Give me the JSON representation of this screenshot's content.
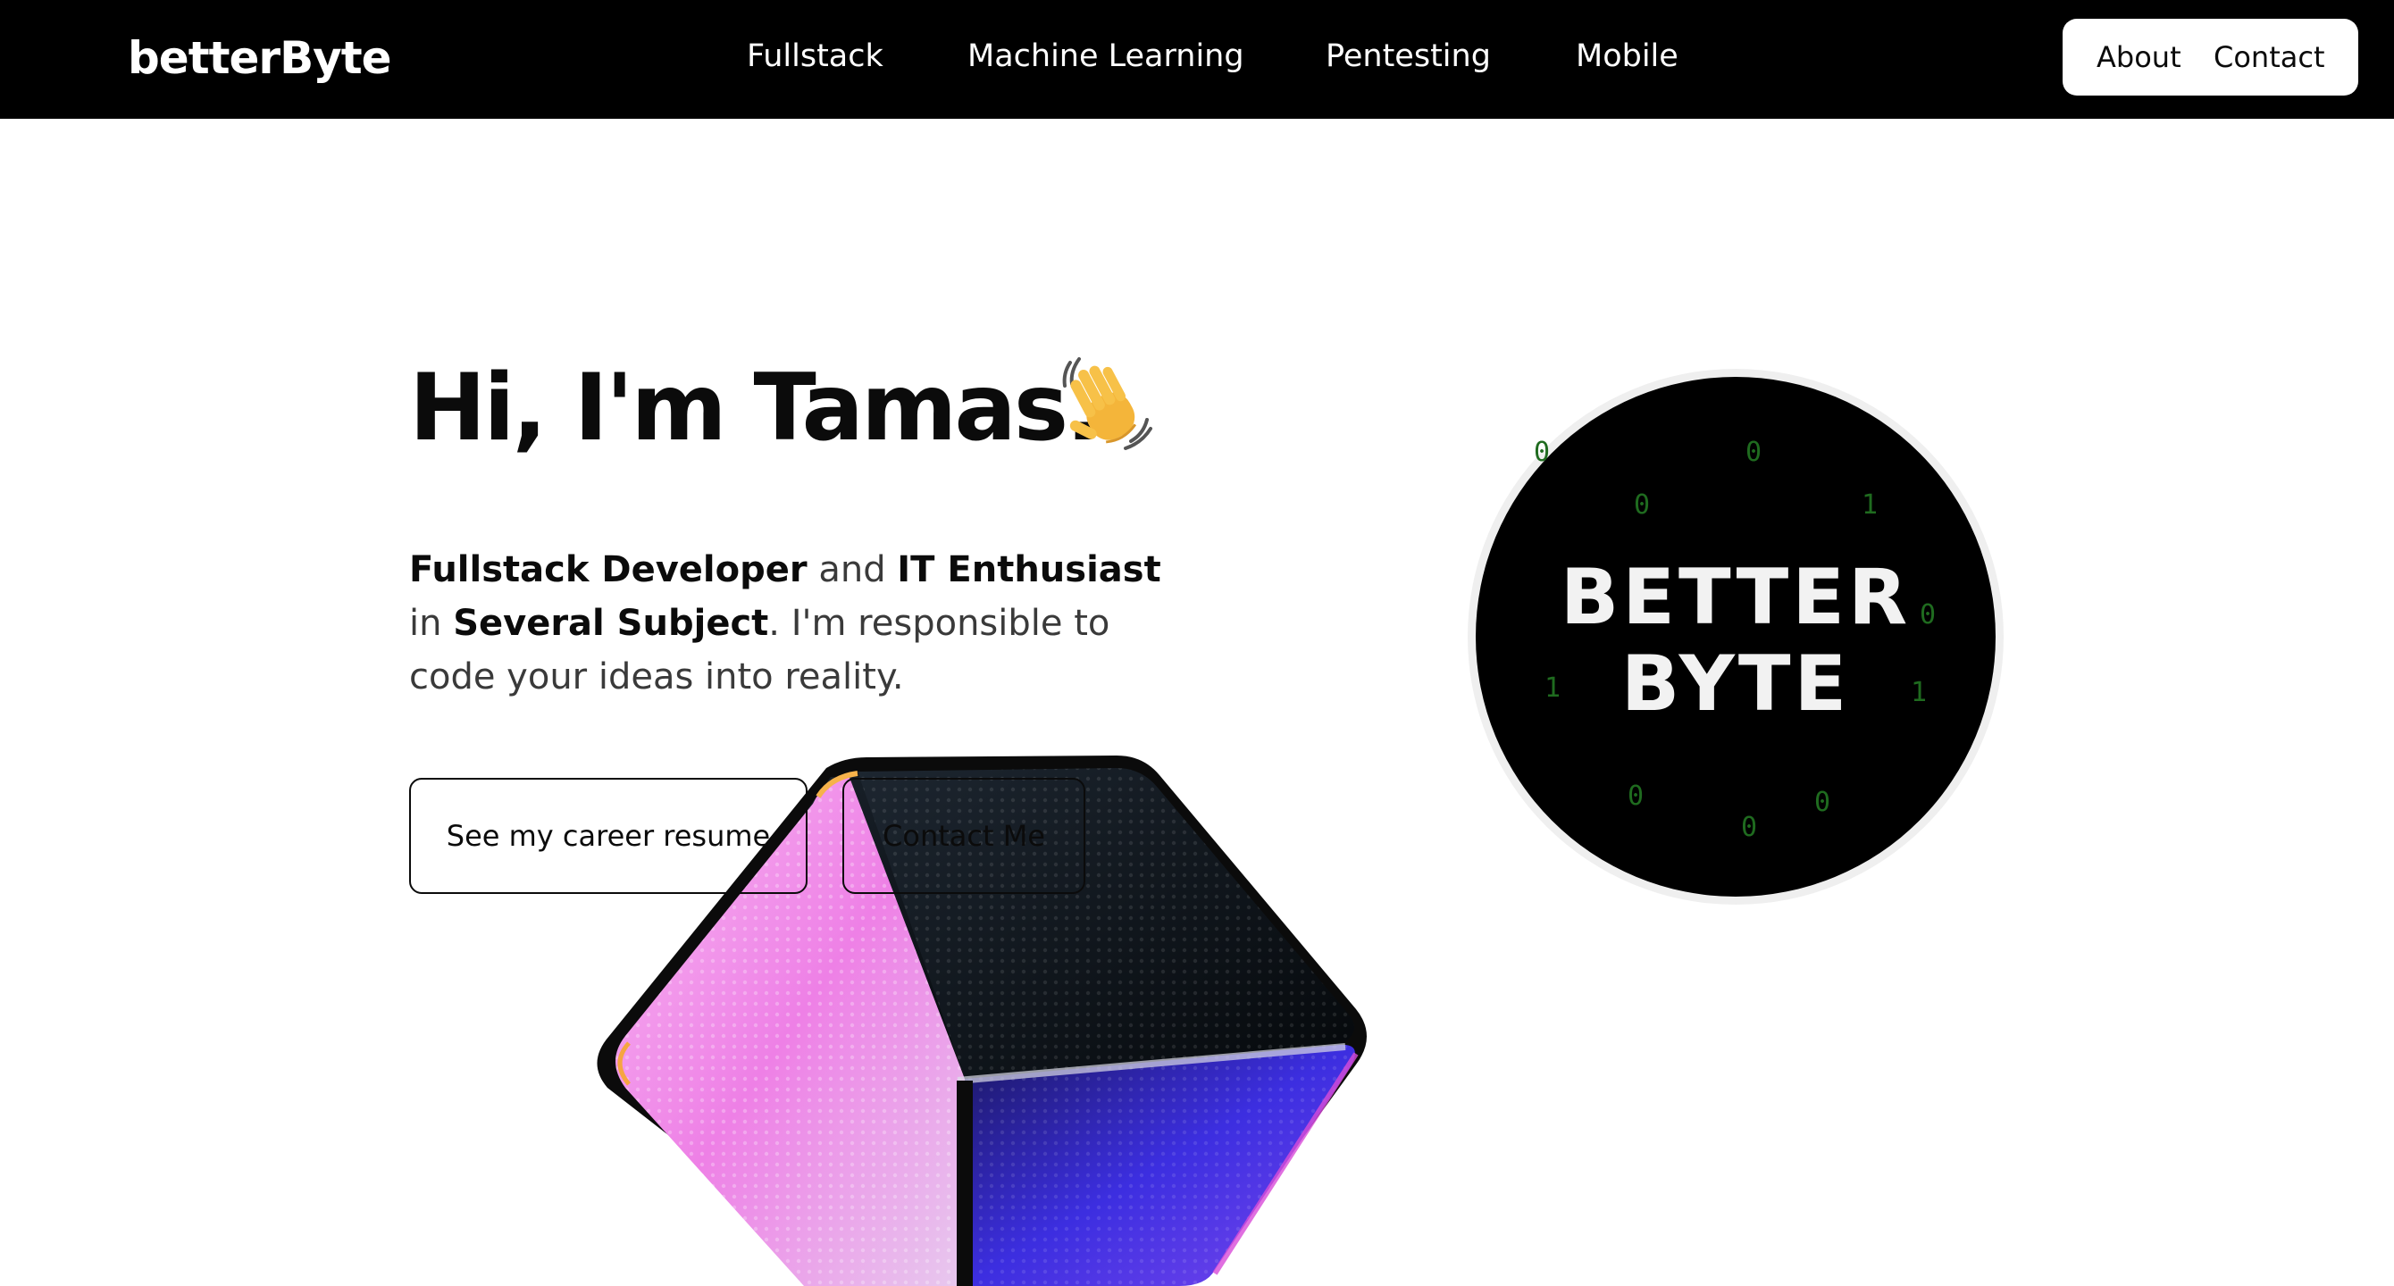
{
  "header": {
    "brand": "betterByte",
    "nav": [
      "Fullstack",
      "Machine Learning",
      "Pentesting",
      "Mobile"
    ],
    "pill_links": [
      "About",
      "Contact"
    ]
  },
  "hero": {
    "title": "Hi, I'm Tamas.",
    "title_icon": "waving-hand-icon",
    "desc": {
      "strong1": "Fullstack Developer",
      "t1": " and ",
      "strong2": "IT Enthusiast",
      "t2": " in ",
      "strong3": "Several Subject",
      "t3": ". I'm responsible to code your ideas into reality."
    },
    "buttons": {
      "resume": "See my career resume",
      "contact": "Contact Me"
    }
  },
  "logo_image": {
    "line1": "BETTER",
    "line2": "BYTE",
    "digits": [
      "0",
      "0",
      "1",
      "0",
      "1",
      "1",
      "0",
      "0",
      "0",
      "0"
    ]
  },
  "colors": {
    "nav_bg": "#000000",
    "text": "#0b0b0b",
    "logo_bg": "#000000",
    "digit_green": "#1f6b1f",
    "cube_pink": "#f08ae8",
    "cube_blue": "#3a2bd8"
  },
  "icons": [
    "waving-hand-icon",
    "cube-illustration",
    "betterbyte-logo-image"
  ]
}
